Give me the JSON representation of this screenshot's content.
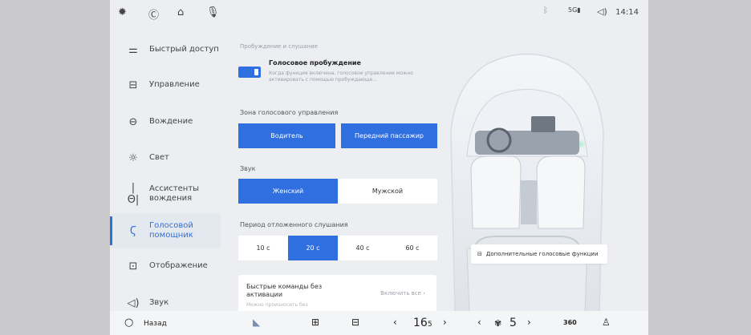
{
  "status_bar": {
    "icons": [
      "tire-icon",
      "refresh-icon",
      "bell-icon",
      "mic-icon",
      "bluetooth-icon",
      "signal-icon",
      "volume-icon"
    ],
    "signal_label": "5G",
    "time": "14:14"
  },
  "sidebar": {
    "items": [
      {
        "label": "Быстрый доступ",
        "icon": "sliders-icon"
      },
      {
        "label": "Управление",
        "icon": "car-icon"
      },
      {
        "label": "Вождение",
        "icon": "steering-wheel-icon"
      },
      {
        "label": "Свет",
        "icon": "light-icon"
      },
      {
        "label": "Ассистенты вождения",
        "icon": "lane-assist-icon"
      },
      {
        "label": "Голосовой помощник",
        "icon": "voice-icon"
      },
      {
        "label": "Отображение",
        "icon": "display-icon"
      },
      {
        "label": "Звук",
        "icon": "speaker-icon"
      }
    ],
    "active_index": 5
  },
  "content": {
    "section_title": "Пробуждение и слушание",
    "voice_wake": {
      "title": "Голосовое пробуждение",
      "description": "Когда функция включена, голосовое управление можно активировать с помощью пробуждающе...",
      "enabled": true
    },
    "zone": {
      "label": "Зона голосового управления",
      "options": [
        "Водитель",
        "Передний пассажир"
      ],
      "selected": [
        0,
        1
      ]
    },
    "sound": {
      "label": "Звук",
      "options": [
        "Женский",
        "Мужской"
      ],
      "selected": 0
    },
    "period": {
      "label": "Период отложенного слушания",
      "options": [
        "10 с",
        "20 с",
        "40 с",
        "60 с"
      ],
      "selected": 1
    },
    "quick_commands": {
      "title": "Быстрые команды без активации",
      "action": "Включить все",
      "subtitle": "Можно произносить без"
    },
    "extra_button": "Дополнительные голосовые функции"
  },
  "bottom_bar": {
    "back_label": "Назад",
    "temperature": "16",
    "temperature_unit": "5",
    "fan_level": "5",
    "view_360": "360"
  }
}
